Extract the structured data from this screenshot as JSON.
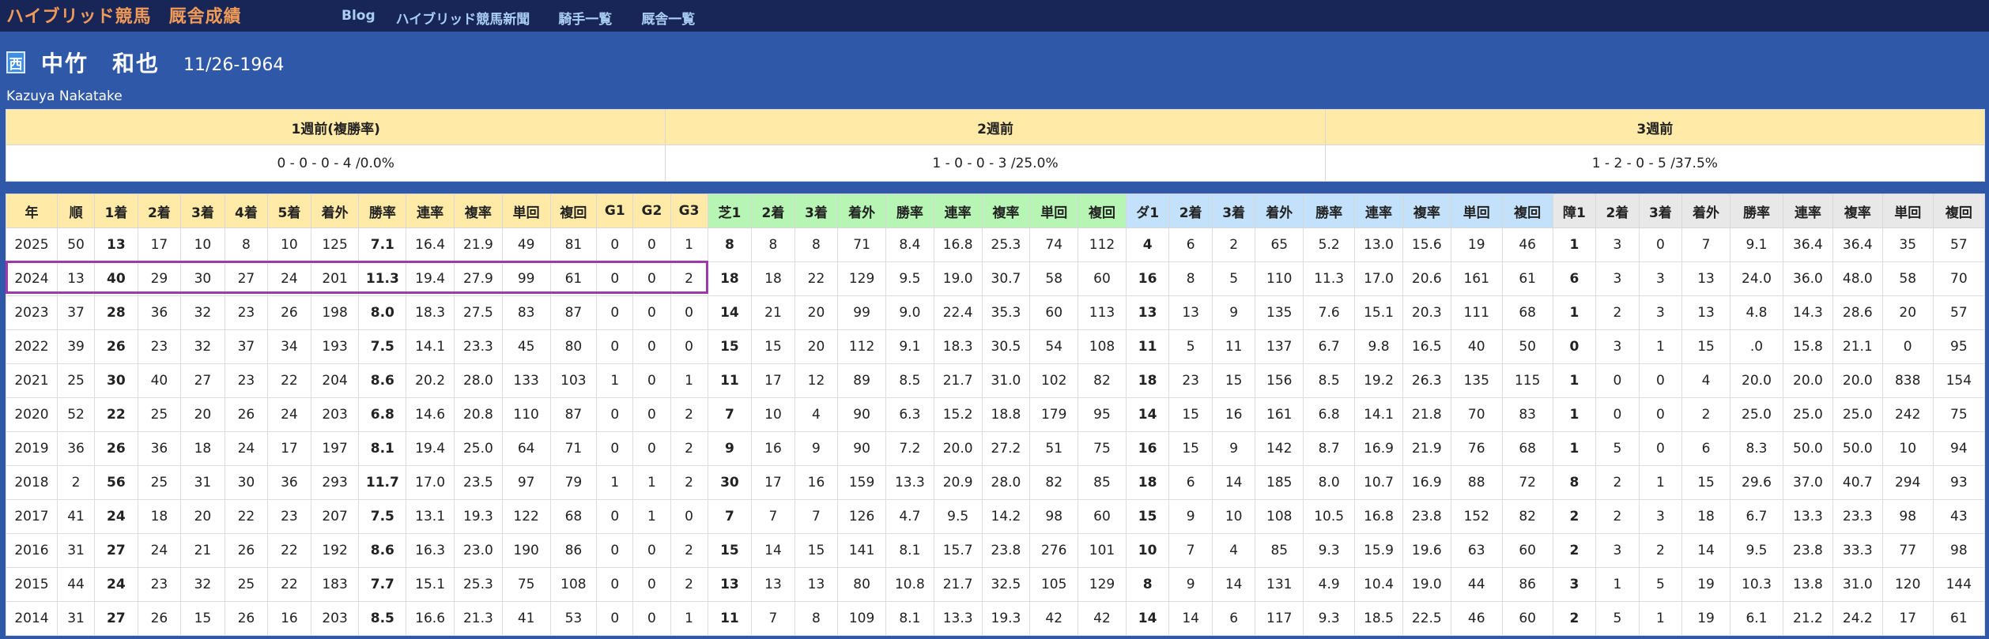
{
  "nav": {
    "brand": "ハイブリッド競馬",
    "brand_section": "厩舎成績",
    "links": [
      "Blog",
      "ハイブリッド競馬新聞",
      "騎手一覧",
      "厩舎一覧"
    ]
  },
  "profile": {
    "region": "西",
    "name": "中竹　和也",
    "dob": "11/26-1964",
    "romaji": "Kazuya Nakatake"
  },
  "weeks": {
    "headers": [
      "1週前(複勝率)",
      "2週前",
      "3週前"
    ],
    "values": [
      "0 - 0 - 0 - 4 /0.0%",
      "1 - 0 - 0 - 3 /25.0%",
      "1 - 2 - 0 - 5 /37.5%"
    ]
  },
  "stats": {
    "headers": [
      "年",
      "順",
      "1着",
      "2着",
      "3着",
      "4着",
      "5着",
      "着外",
      "勝率",
      "連率",
      "複率",
      "単回",
      "複回",
      "G1",
      "G2",
      "G3",
      "芝1",
      "2着",
      "3着",
      "着外",
      "勝率",
      "連率",
      "複率",
      "単回",
      "複回",
      "ダ1",
      "2着",
      "3着",
      "着外",
      "勝率",
      "連率",
      "複率",
      "単回",
      "複回",
      "障1",
      "2着",
      "3着",
      "着外",
      "勝率",
      "連率",
      "複率",
      "単回",
      "複回"
    ],
    "highlight_row": "2024",
    "rows": [
      [
        "2025",
        "50",
        "13",
        "17",
        "10",
        "8",
        "10",
        "125",
        "7.1",
        "16.4",
        "21.9",
        "49",
        "81",
        "0",
        "0",
        "1",
        "8",
        "8",
        "8",
        "71",
        "8.4",
        "16.8",
        "25.3",
        "74",
        "112",
        "4",
        "6",
        "2",
        "65",
        "5.2",
        "13.0",
        "15.6",
        "19",
        "46",
        "1",
        "3",
        "0",
        "7",
        "9.1",
        "36.4",
        "36.4",
        "35",
        "57"
      ],
      [
        "2024",
        "13",
        "40",
        "29",
        "30",
        "27",
        "24",
        "201",
        "11.3",
        "19.4",
        "27.9",
        "99",
        "61",
        "0",
        "0",
        "2",
        "18",
        "18",
        "22",
        "129",
        "9.5",
        "19.0",
        "30.7",
        "58",
        "60",
        "16",
        "8",
        "5",
        "110",
        "11.3",
        "17.0",
        "20.6",
        "161",
        "61",
        "6",
        "3",
        "3",
        "13",
        "24.0",
        "36.0",
        "48.0",
        "58",
        "70"
      ],
      [
        "2023",
        "37",
        "28",
        "36",
        "32",
        "23",
        "26",
        "198",
        "8.0",
        "18.3",
        "27.5",
        "83",
        "87",
        "0",
        "0",
        "0",
        "14",
        "21",
        "20",
        "99",
        "9.0",
        "22.4",
        "35.3",
        "60",
        "113",
        "13",
        "13",
        "9",
        "135",
        "7.6",
        "15.1",
        "20.3",
        "111",
        "68",
        "1",
        "2",
        "3",
        "13",
        "4.8",
        "14.3",
        "28.6",
        "20",
        "57"
      ],
      [
        "2022",
        "39",
        "26",
        "23",
        "32",
        "37",
        "34",
        "193",
        "7.5",
        "14.1",
        "23.3",
        "45",
        "80",
        "0",
        "0",
        "0",
        "15",
        "15",
        "20",
        "112",
        "9.1",
        "18.3",
        "30.5",
        "54",
        "108",
        "11",
        "5",
        "11",
        "137",
        "6.7",
        "9.8",
        "16.5",
        "40",
        "50",
        "0",
        "3",
        "1",
        "15",
        ".0",
        "15.8",
        "21.1",
        "0",
        "95"
      ],
      [
        "2021",
        "25",
        "30",
        "40",
        "27",
        "23",
        "22",
        "204",
        "8.6",
        "20.2",
        "28.0",
        "133",
        "103",
        "1",
        "0",
        "1",
        "11",
        "17",
        "12",
        "89",
        "8.5",
        "21.7",
        "31.0",
        "102",
        "82",
        "18",
        "23",
        "15",
        "156",
        "8.5",
        "19.2",
        "26.3",
        "135",
        "115",
        "1",
        "0",
        "0",
        "4",
        "20.0",
        "20.0",
        "20.0",
        "838",
        "154"
      ],
      [
        "2020",
        "52",
        "22",
        "25",
        "20",
        "26",
        "24",
        "203",
        "6.8",
        "14.6",
        "20.8",
        "110",
        "87",
        "0",
        "0",
        "2",
        "7",
        "10",
        "4",
        "90",
        "6.3",
        "15.2",
        "18.8",
        "179",
        "95",
        "14",
        "15",
        "16",
        "161",
        "6.8",
        "14.1",
        "21.8",
        "70",
        "83",
        "1",
        "0",
        "0",
        "2",
        "25.0",
        "25.0",
        "25.0",
        "242",
        "75"
      ],
      [
        "2019",
        "36",
        "26",
        "36",
        "18",
        "24",
        "17",
        "197",
        "8.1",
        "19.4",
        "25.0",
        "64",
        "71",
        "0",
        "0",
        "2",
        "9",
        "16",
        "9",
        "90",
        "7.2",
        "20.0",
        "27.2",
        "51",
        "75",
        "16",
        "15",
        "9",
        "142",
        "8.7",
        "16.9",
        "21.9",
        "76",
        "68",
        "1",
        "5",
        "0",
        "6",
        "8.3",
        "50.0",
        "50.0",
        "10",
        "94"
      ],
      [
        "2018",
        "2",
        "56",
        "25",
        "31",
        "30",
        "36",
        "293",
        "11.7",
        "17.0",
        "23.5",
        "97",
        "79",
        "1",
        "1",
        "2",
        "30",
        "17",
        "16",
        "159",
        "13.3",
        "20.9",
        "28.0",
        "82",
        "85",
        "18",
        "6",
        "14",
        "185",
        "8.0",
        "10.7",
        "16.9",
        "88",
        "72",
        "8",
        "2",
        "1",
        "15",
        "29.6",
        "37.0",
        "40.7",
        "294",
        "93"
      ],
      [
        "2017",
        "41",
        "24",
        "18",
        "20",
        "22",
        "23",
        "207",
        "7.5",
        "13.1",
        "19.3",
        "122",
        "68",
        "0",
        "1",
        "0",
        "7",
        "7",
        "7",
        "126",
        "4.7",
        "9.5",
        "14.2",
        "98",
        "60",
        "15",
        "9",
        "10",
        "108",
        "10.5",
        "16.8",
        "23.8",
        "152",
        "82",
        "2",
        "2",
        "3",
        "18",
        "6.7",
        "13.3",
        "23.3",
        "98",
        "43"
      ],
      [
        "2016",
        "31",
        "27",
        "24",
        "21",
        "26",
        "22",
        "192",
        "8.6",
        "16.3",
        "23.0",
        "190",
        "86",
        "0",
        "0",
        "2",
        "15",
        "14",
        "15",
        "141",
        "8.1",
        "15.7",
        "23.8",
        "276",
        "101",
        "10",
        "7",
        "4",
        "85",
        "9.3",
        "15.9",
        "19.6",
        "63",
        "60",
        "2",
        "3",
        "2",
        "14",
        "9.5",
        "23.8",
        "33.3",
        "77",
        "98"
      ],
      [
        "2015",
        "44",
        "24",
        "23",
        "32",
        "25",
        "22",
        "183",
        "7.7",
        "15.1",
        "25.3",
        "75",
        "108",
        "0",
        "0",
        "2",
        "13",
        "13",
        "13",
        "80",
        "10.8",
        "21.7",
        "32.5",
        "105",
        "129",
        "8",
        "9",
        "14",
        "131",
        "4.9",
        "10.4",
        "19.0",
        "44",
        "86",
        "3",
        "1",
        "5",
        "19",
        "10.3",
        "13.8",
        "31.0",
        "120",
        "144"
      ],
      [
        "2014",
        "31",
        "27",
        "26",
        "15",
        "26",
        "16",
        "203",
        "8.5",
        "16.6",
        "21.3",
        "41",
        "53",
        "0",
        "0",
        "1",
        "11",
        "7",
        "8",
        "109",
        "8.1",
        "13.3",
        "19.3",
        "42",
        "42",
        "14",
        "14",
        "6",
        "117",
        "9.3",
        "18.5",
        "22.5",
        "46",
        "60",
        "2",
        "5",
        "1",
        "19",
        "6.1",
        "21.2",
        "24.2",
        "17",
        "61"
      ]
    ]
  }
}
